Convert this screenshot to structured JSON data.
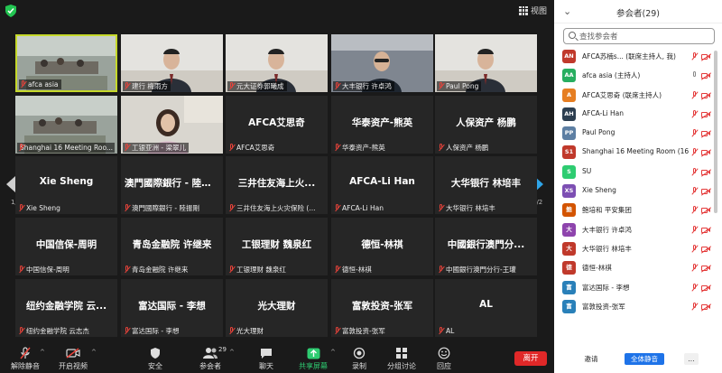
{
  "topbar": {
    "view_label": "视图"
  },
  "pager": {
    "left_page": "1/2",
    "right_page": "1/2"
  },
  "tiles": [
    {
      "type": "video",
      "caption": "afca asia",
      "active": true,
      "scene": "room"
    },
    {
      "type": "video",
      "caption": "建行 梅雨方",
      "scene": "person-light"
    },
    {
      "type": "video",
      "caption": "元大证券郭曦成",
      "scene": "person-light"
    },
    {
      "type": "video",
      "caption": "大丰银行 许卓鸿",
      "scene": "person-dark"
    },
    {
      "type": "video",
      "caption": "Paul Pong",
      "scene": "person-light"
    },
    {
      "type": "video",
      "caption": "Shanghai 16 Meeting Roo...",
      "scene": "room"
    },
    {
      "type": "video",
      "caption": "工银亚洲 - 梁翠儿",
      "scene": "person-woman"
    },
    {
      "type": "name",
      "name": "AFCA艾思奇",
      "caption": "AFCA艾思奇"
    },
    {
      "type": "name",
      "name": "华泰资产-熊英",
      "caption": "华泰资产-熊英"
    },
    {
      "type": "name",
      "name": "人保资产 杨鹏",
      "caption": "人保资产 杨鹏"
    },
    {
      "type": "name",
      "name": "Xie Sheng",
      "caption": "Xie Sheng"
    },
    {
      "type": "name",
      "name": "澳門國際銀行 - 陸振剛",
      "caption": "澳門國際銀行 - 陸振剛"
    },
    {
      "type": "name",
      "name": "三井住友海上火...",
      "caption": "三井住友海上火灾保险 (..."
    },
    {
      "type": "name",
      "name": "AFCA-Li Han",
      "caption": "AFCA-Li Han"
    },
    {
      "type": "name",
      "name": "大华银行 林培丰",
      "caption": "大华银行 林培丰"
    },
    {
      "type": "name",
      "name": "中国信保-周明",
      "caption": "中国信保-周明"
    },
    {
      "type": "name",
      "name": "青岛金融院 许继来",
      "caption": "青岛金融院 许继来"
    },
    {
      "type": "name",
      "name": "工银理财 魏泉红",
      "caption": "工银理财 魏泉红"
    },
    {
      "type": "name",
      "name": "德恒-林祺",
      "caption": "德恒-林祺"
    },
    {
      "type": "name",
      "name": "中國銀行澳門分...",
      "caption": "中國銀行澳門分行-王瓘"
    },
    {
      "type": "name",
      "name": "纽约金融学院 云...",
      "caption": "纽约金融学院 云志杰"
    },
    {
      "type": "name",
      "name": "富达国际 - 李想",
      "caption": "富达国际 - 李想"
    },
    {
      "type": "name",
      "name": "光大理财",
      "caption": "光大理财"
    },
    {
      "type": "name",
      "name": "富敦投资-张军",
      "caption": "富敦投资-张军"
    },
    {
      "type": "name",
      "name": "AL",
      "caption": "AL"
    }
  ],
  "toolbar": {
    "mute_label": "解除静音",
    "video_label": "开启视频",
    "security_label": "安全",
    "participants_label": "参会者",
    "participants_count": "29",
    "chat_label": "聊天",
    "share_label": "共享屏幕",
    "record_label": "录制",
    "breakout_label": "分组讨论",
    "reactions_label": "回应",
    "leave_label": "离开"
  },
  "panel": {
    "title": "参会者(29)",
    "search_placeholder": "查找参会者",
    "invite_label": "邀请",
    "mute_all_label": "全体静音",
    "more_label": "...",
    "participants": [
      {
        "initials": "AN",
        "color": "#c0392b",
        "name": "AFCA苏楠s... (联席主持人, 我)",
        "mic": "off",
        "cam": "off"
      },
      {
        "initials": "AA",
        "color": "#27ae60",
        "name": "afca asia (主持人)",
        "mic": "on",
        "cam": "off"
      },
      {
        "initials": "A",
        "color": "#e67e22",
        "name": "AFCA艾思奇 (联席主持人)",
        "mic": "off",
        "cam": "off"
      },
      {
        "initials": "AH",
        "color": "#2c3e50",
        "name": "AFCA-Li Han",
        "mic": "off",
        "cam": "off"
      },
      {
        "initials": "PP",
        "color": "#5d7fa3",
        "name": "Paul Pong",
        "mic": "off",
        "cam": "off"
      },
      {
        "initials": "S1",
        "color": "#c0392b",
        "name": "Shanghai 16 Meeting Room (16...",
        "mic": "off",
        "cam": "off"
      },
      {
        "initials": "S",
        "color": "#2ecc71",
        "name": "SU",
        "mic": "off",
        "cam": "off"
      },
      {
        "initials": "XS",
        "color": "#7d4fb3",
        "name": "Xie Sheng",
        "mic": "off",
        "cam": "off"
      },
      {
        "initials": "鲍",
        "color": "#d35400",
        "name": "鲍培和 平安集团",
        "mic": "off",
        "cam": "off"
      },
      {
        "initials": "大",
        "color": "#8e44ad",
        "name": "大丰银行 许卓鸿",
        "mic": "off",
        "cam": "off"
      },
      {
        "initials": "大",
        "color": "#c0392b",
        "name": "大华银行 林培丰",
        "mic": "off",
        "cam": "off"
      },
      {
        "initials": "德",
        "color": "#c0392b",
        "name": "德恒-林祺",
        "mic": "off",
        "cam": "off"
      },
      {
        "initials": "富",
        "color": "#2980b9",
        "name": "富达国际 - 李想",
        "mic": "off",
        "cam": "off"
      },
      {
        "initials": "富",
        "color": "#2980b9",
        "name": "富敦投资-张军",
        "mic": "off",
        "cam": "off"
      }
    ]
  },
  "colors": {
    "active_speaker": "#c5d82a",
    "accent_blue": "#1e73e8",
    "leave_red": "#e02828",
    "muted_red": "#e43a3a"
  }
}
